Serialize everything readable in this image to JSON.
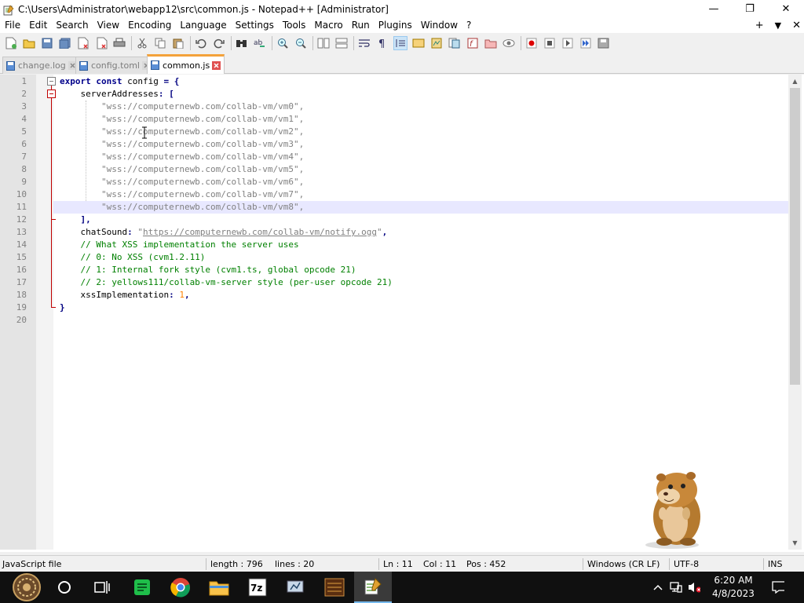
{
  "window": {
    "title": "C:\\Users\\Administrator\\webapp12\\src\\common.js - Notepad++ [Administrator]",
    "minimize": "—",
    "restore": "❐",
    "close": "✕"
  },
  "menu": {
    "items": [
      "File",
      "Edit",
      "Search",
      "View",
      "Encoding",
      "Language",
      "Settings",
      "Tools",
      "Macro",
      "Run",
      "Plugins",
      "Window",
      "?"
    ],
    "add": "+",
    "dropdown": "▼",
    "close": "✕"
  },
  "tabs": [
    {
      "label": "change.log",
      "active": false
    },
    {
      "label": "config.toml",
      "active": false
    },
    {
      "label": "common.js",
      "active": true
    }
  ],
  "editor": {
    "lines": [
      {
        "n": "1",
        "text": "export const config = {"
      },
      {
        "n": "2",
        "text": "    serverAddresses: ["
      },
      {
        "n": "3",
        "text": "        \"wss://computernewb.com/collab-vm/vm0\","
      },
      {
        "n": "4",
        "text": "        \"wss://computernewb.com/collab-vm/vm1\","
      },
      {
        "n": "5",
        "text": "        \"wss://computernewb.com/collab-vm/vm2\","
      },
      {
        "n": "6",
        "text": "        \"wss://computernewb.com/collab-vm/vm3\","
      },
      {
        "n": "7",
        "text": "        \"wss://computernewb.com/collab-vm/vm4\","
      },
      {
        "n": "8",
        "text": "        \"wss://computernewb.com/collab-vm/vm5\","
      },
      {
        "n": "9",
        "text": "        \"wss://computernewb.com/collab-vm/vm6\","
      },
      {
        "n": "10",
        "text": "        \"wss://computernewb.com/collab-vm/vm7\","
      },
      {
        "n": "11",
        "text": "        \"wss://computernewb.com/collab-vm/vm8\","
      },
      {
        "n": "12",
        "text": "    ],"
      },
      {
        "n": "13",
        "text": "    chatSound: \"https://computernewb.com/collab-vm/notify.ogg\","
      },
      {
        "n": "14",
        "text": "    // What XSS implementation the server uses"
      },
      {
        "n": "15",
        "text": "    // 0: No XSS (cvm1.2.11)"
      },
      {
        "n": "16",
        "text": "    // 1: Internal fork style (cvm1.ts, global opcode 21)"
      },
      {
        "n": "17",
        "text": "    // 2: yellows111/collab-vm-server style (per-user opcode 21)"
      },
      {
        "n": "18",
        "text": "    xssImplementation: 1,"
      },
      {
        "n": "19",
        "text": "}"
      },
      {
        "n": "20",
        "text": ""
      }
    ],
    "current_line": 11
  },
  "status": {
    "file_type": "JavaScript file",
    "length": "length : 796",
    "lines": "lines : 20",
    "ln": "Ln : 11",
    "col": "Col : 11",
    "pos": "Pos : 452",
    "eol": "Windows (CR LF)",
    "encoding": "UTF-8",
    "mode": "INS"
  },
  "taskbar": {
    "time": "6:20 AM",
    "date": "4/8/2023",
    "apps": [
      "start",
      "cortana",
      "task-view",
      "notepad-green",
      "chrome",
      "file-explorer",
      "7zip",
      "system-tool",
      "game",
      "notepad-plus-plus"
    ]
  }
}
